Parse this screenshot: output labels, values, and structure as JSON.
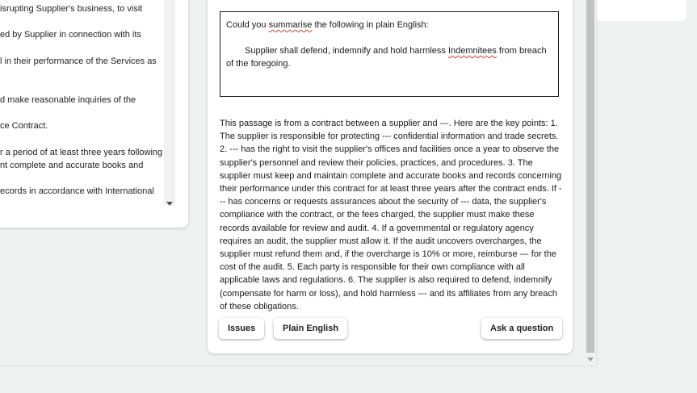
{
  "document_panel": {
    "lines": [
      "isrupting Supplier's business, to visit",
      "ed by Supplier in connection with its",
      "l in their performance of the Services as",
      "d make reasonable inquiries of the",
      "ce Contract.",
      "r a period of at least three years following",
      "nt complete and accurate books and",
      "ecords in accordance with International"
    ]
  },
  "chat": {
    "prompt": {
      "line1_before": "Could you ",
      "line1_misspelled": "summarise",
      "line1_after": " the following in plain English:",
      "line2_before": "Supplier shall defend, indemnify and hold harmless ",
      "line2_misspelled": "Indemnitees",
      "line2_after": " from breach of the foregoing."
    },
    "response": "This passage is from a contract between a supplier and ---. Here are the key points: 1. The supplier is responsible for protecting --- confidential information and trade secrets. 2. --- has the right to visit the supplier's offices and facilities once a year to observe the supplier's personnel and review their policies, practices, and procedures. 3. The supplier must keep and maintain complete and accurate books and records concerning their performance under this contract for at least three years after the contract ends. If --- has concerns or requests assurances about the security of --- data, the supplier's compliance with the contract, or the fees charged, the supplier must make these records available for review and audit. 4. If a governmental or regulatory agency requires an audit, the supplier must allow it. If the audit uncovers overcharges, the supplier must refund them and, if the overcharge is 10% or more, reimburse --- for the cost of the audit. 5. Each party is responsible for their own compliance with all applicable laws and regulations. 6. The supplier is also required to defend, indemnify (compensate for harm or loss), and hold harmless --- and its affiliates from any breach of these obligations.",
    "buttons": {
      "issues": "Issues",
      "plain_english": "Plain English",
      "ask": "Ask a question"
    }
  }
}
